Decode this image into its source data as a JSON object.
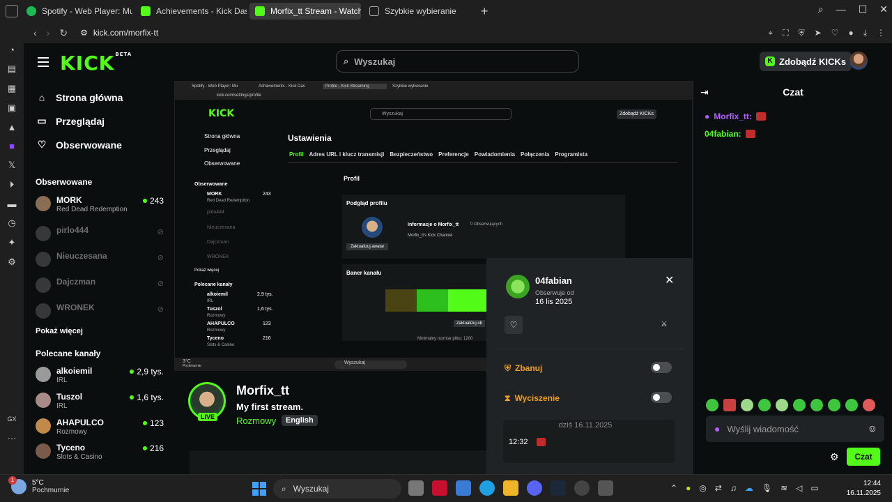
{
  "browser": {
    "tabs": [
      {
        "label": "Spotify - Web Player: Mu",
        "color": "#1db954"
      },
      {
        "label": "Achievements - Kick Das",
        "color": "#53fc18"
      },
      {
        "label": "Morfix_tt Stream - Watch",
        "color": "#53fc18",
        "active": true
      },
      {
        "label": "Szybkie wybieranie",
        "color": "#888888"
      }
    ],
    "url": "kick.com/morfix-tt"
  },
  "header": {
    "logo": "KICK",
    "logo_beta": "BETA",
    "search_placeholder": "Wyszukaj",
    "kicks_button": "Zdobądź KICKs"
  },
  "sidebar": {
    "nav": [
      {
        "label": "Strona główna",
        "icon": "home-icon"
      },
      {
        "label": "Przeglądaj",
        "icon": "browse-icon"
      },
      {
        "label": "Obserwowane",
        "icon": "heart-icon"
      }
    ],
    "followed_title": "Obserwowane",
    "followed": [
      {
        "name": "MORK",
        "sub": "Red Dead Redemption",
        "count": "243",
        "online": true
      },
      {
        "name": "pirlo444",
        "online": false
      },
      {
        "name": "Nieuczesana",
        "online": false
      },
      {
        "name": "Dajczman",
        "online": false
      },
      {
        "name": "WRONEK",
        "online": false
      }
    ],
    "show_more": "Pokaż więcej",
    "recommended_title": "Polecane kanały",
    "recommended": [
      {
        "name": "alkoiemil",
        "sub": "IRL",
        "count": "2,9 tys."
      },
      {
        "name": "Tuszol",
        "sub": "IRL",
        "count": "1,6 tys."
      },
      {
        "name": "AHAPULCO",
        "sub": "Rozmowy",
        "count": "123"
      },
      {
        "name": "Tyceno",
        "sub": "Slots & Casino",
        "count": "216"
      }
    ]
  },
  "embedded": {
    "tabs": [
      "Spotify - Web Player: Mu",
      "Achievements - Kick Das",
      "Profile - Kick Streaming",
      "Szybkie wybieranie"
    ],
    "url": "kick.com/settings/profile",
    "search": "Wyszukaj",
    "kicks": "Zdobądź KICKs",
    "side": {
      "nav": [
        "Strona główna",
        "Przeglądaj",
        "Obserwowane"
      ],
      "followed_title": "Obserwowane",
      "followed": [
        {
          "name": "MORK",
          "sub": "Red Dead Redemption",
          "count": "243"
        },
        {
          "name": "pirlo444"
        },
        {
          "name": "Nieuczesana"
        },
        {
          "name": "Dajczman"
        },
        {
          "name": "WRONEK"
        }
      ],
      "show_more": "Pokaż więcej",
      "recommended_title": "Polecane kanały",
      "recommended": [
        {
          "name": "alkoiemil",
          "sub": "IRL",
          "count": "2,9 tys."
        },
        {
          "name": "Tuszol",
          "sub": "Rozmowy",
          "count": "1,6 tys."
        },
        {
          "name": "AHAPULCO",
          "sub": "Rozmowy",
          "count": "123"
        },
        {
          "name": "Tyceno",
          "sub": "Slots & Casino",
          "count": "216"
        }
      ]
    },
    "settings_title": "Ustawienia",
    "settings_tabs": [
      "Profil",
      "Adres URL i klucz transmisji",
      "Bezpieczeństwo",
      "Preferencje",
      "Powiadomienia",
      "Połączenia",
      "Programista"
    ],
    "profile_label": "Profil",
    "preview_label": "Podgląd profilu",
    "info_label": "Informacje o Morfix_tt",
    "followers_label": "0 Obserwujących",
    "bio": "Morfix_tt's Kick Channel",
    "update_avatar": "Zaktualizuj awatar",
    "banner_label": "Baner kanału",
    "update_banner": "Zaktualizuj ob",
    "min_size": "Minimalny rozmiar pliku: 1200",
    "weather": "3°C",
    "weather_sub": "Pochmurnie",
    "taskbar_search": "Wyszukaj"
  },
  "stream": {
    "name": "Morfix_tt",
    "title": "My first stream.",
    "category": "Rozmowy",
    "language": "English",
    "live_badge": "LIVE"
  },
  "popup": {
    "username": "04fabian",
    "follow_label": "Obserwuje od",
    "follow_date": "16 lis 2025",
    "ban_label": "Zbanuj",
    "mute_label": "Wyciszenie",
    "log_date": "dziś 16.11.2025",
    "log_time": "12:32"
  },
  "chat": {
    "title": "Czat",
    "messages": [
      {
        "user": "Morfix_tt:",
        "color": "#b35cff",
        "mic": true
      },
      {
        "user": "04fabian:",
        "color": "#53fc18",
        "mic": false
      }
    ],
    "input_placeholder": "Wyślij wiadomość",
    "send": "Czat"
  },
  "taskbar": {
    "weather_temp": "5°C",
    "weather_desc": "Pochmurnie",
    "weather_badge": "1",
    "search": "Wyszukaj",
    "time": "12:44",
    "date": "16.11.2025"
  }
}
